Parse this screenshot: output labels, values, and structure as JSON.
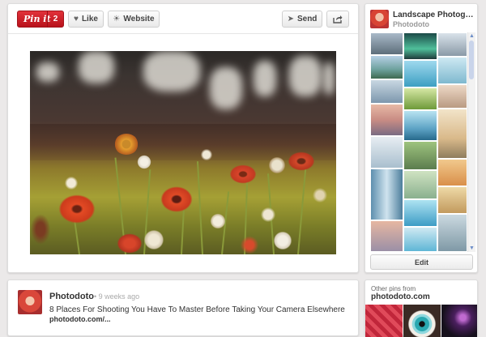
{
  "toolbar": {
    "pinit_label": "Pin it",
    "pinit_count": "2",
    "like_label": "Like",
    "website_label": "Website",
    "send_label": "Send"
  },
  "icons": {
    "like": "heart-icon",
    "website": "globe-icon",
    "send": "arrow-icon",
    "share": "share-icon"
  },
  "board": {
    "title": "Landscape Photogra...",
    "owner": "Photodoto",
    "edit_label": "Edit"
  },
  "pin": {
    "pinner": "Photodoto",
    "age": "• 9 weeks ago",
    "description": "8 Places For Shooting You Have To Master Before Taking Your Camera Elsewhere",
    "source": "photodoto.com/..."
  },
  "other_pins": {
    "label": "Other pins from",
    "source": "photodoto.com"
  },
  "colors": {
    "pinit_red": "#cb2027",
    "background": "#ebe9e9"
  }
}
